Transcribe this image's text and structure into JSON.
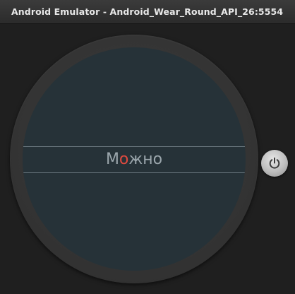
{
  "window": {
    "title": "Android Emulator - Android_Wear_Round_API_26:5554"
  },
  "watch_screen": {
    "picker_text_before": "М",
    "picker_text_highlight": "о",
    "picker_text_after": "жно"
  },
  "colors": {
    "screen_background": "#263238",
    "highlight": "#e04a3f",
    "text": "#9ba6ac"
  },
  "icons": {
    "power": "power-icon"
  }
}
